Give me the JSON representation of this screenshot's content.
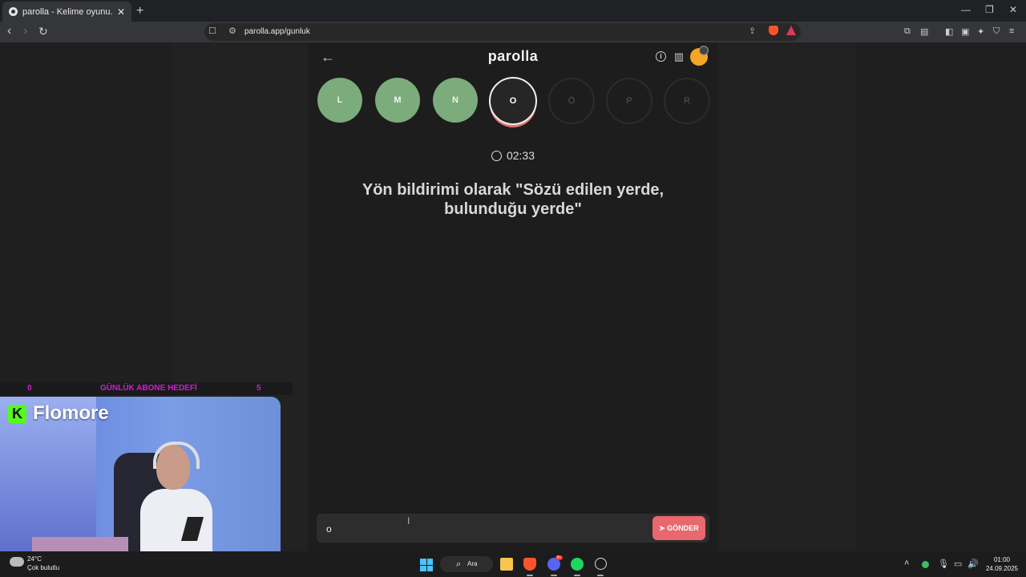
{
  "browser": {
    "tab_title": "parolla - Kelime oyunu. Günlük k",
    "url": "parolla.app/gunluk",
    "shields_count": "1"
  },
  "game": {
    "logo": "parolla",
    "letters": [
      {
        "letter": "L",
        "state": "done"
      },
      {
        "letter": "M",
        "state": "done"
      },
      {
        "letter": "N",
        "state": "done"
      },
      {
        "letter": "O",
        "state": "current"
      },
      {
        "letter": "Ö",
        "state": "pending"
      },
      {
        "letter": "P",
        "state": "pending"
      },
      {
        "letter": "R",
        "state": "pending"
      }
    ],
    "timer": "02:33",
    "question": "Yön bildirimi olarak \"Sözü edilen yerde, bulunduğu yerde\"",
    "answer_value": "o",
    "send_label": "GÖNDER",
    "colors": {
      "done": "#7cab7c",
      "send": "#e8686e",
      "current_ring": "#e57373"
    }
  },
  "overlay": {
    "goal_left": "0",
    "goal_label": "GÜNLÜK ABONE HEDEFİ",
    "goal_right": "5",
    "streamer_name": "Flomore",
    "platform_letter": "K"
  },
  "taskbar": {
    "weather_temp": "24°C",
    "weather_text": "Çok bulutlu",
    "search_label": "Ara",
    "discord_badge": "9+",
    "time": "01:00",
    "date": "24.09.2025"
  }
}
